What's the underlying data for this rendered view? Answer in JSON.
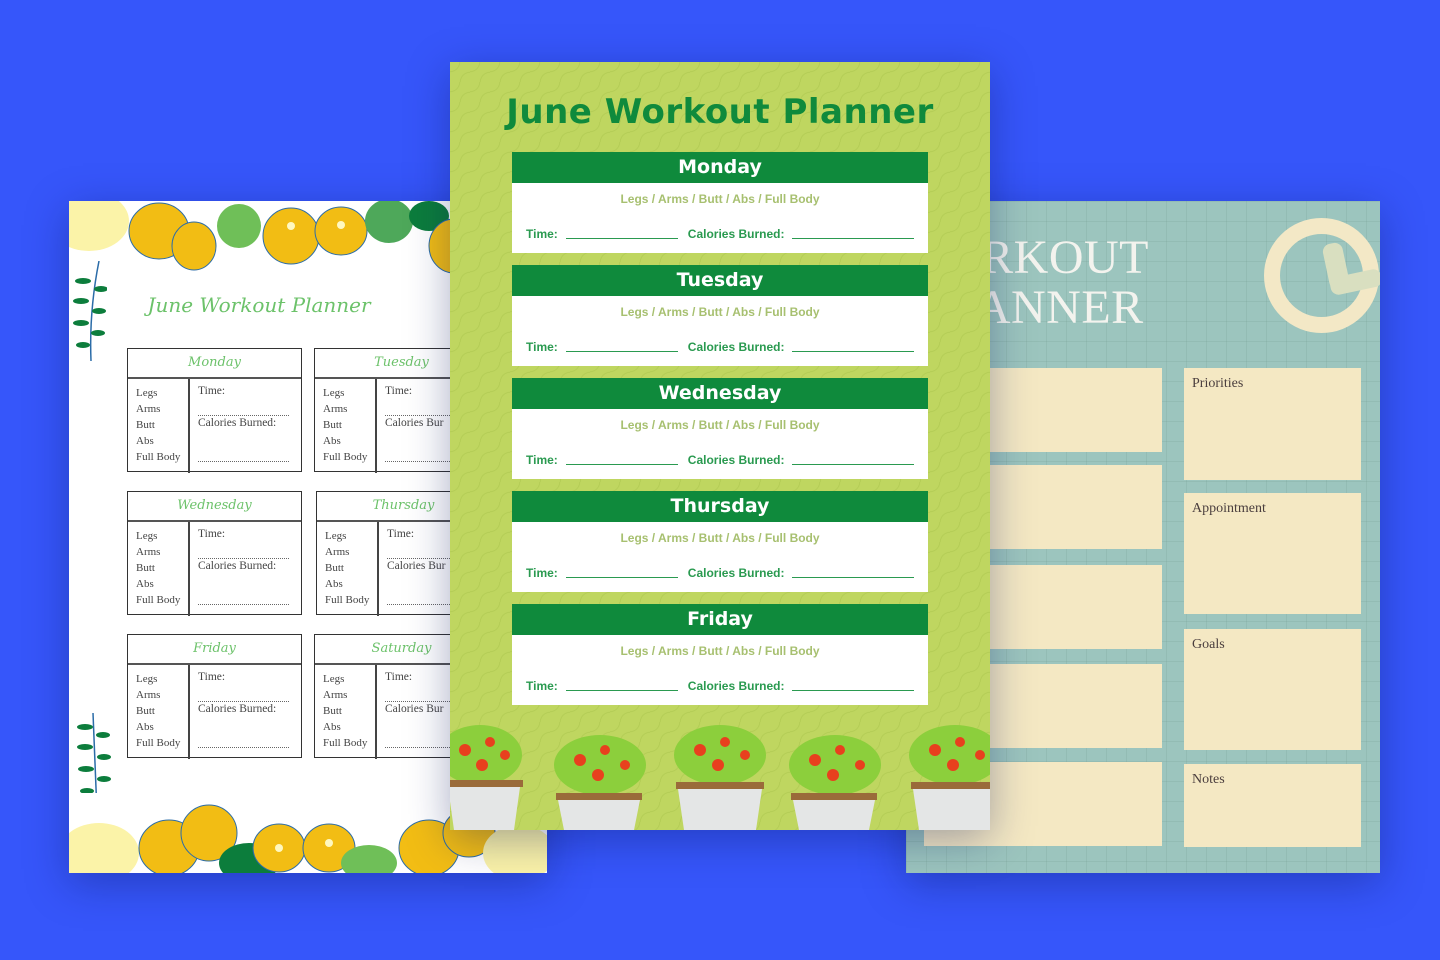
{
  "background_color": "#3656FA",
  "left_planner": {
    "title": "June Workout Planner",
    "title_color": "#6CC26A",
    "body_parts": [
      "Legs",
      "Arms",
      "Butt",
      "Abs",
      "Full Body"
    ],
    "time_label": "Time:",
    "calories_label": "Calories Burned:",
    "days": [
      {
        "name": "Monday"
      },
      {
        "name": "Tuesday"
      },
      {
        "name": "Wednesday"
      },
      {
        "name": "Thursday"
      },
      {
        "name": "Friday"
      },
      {
        "name": "Saturday"
      }
    ],
    "calories_truncated": "Calories Bur"
  },
  "center_planner": {
    "title": "June Workout Planner",
    "accent_color": "#0F8A3C",
    "background_color": "#BFD660",
    "categories": "Legs / Arms / Butt / Abs / Full Body",
    "time_label": "Time:",
    "calories_label": "Calories Burned:",
    "days": [
      {
        "name": "Monday"
      },
      {
        "name": "Tuesday"
      },
      {
        "name": "Wednesday"
      },
      {
        "name": "Thursday"
      },
      {
        "name": "Friday"
      }
    ]
  },
  "right_planner": {
    "title_line1": "ORKOUT",
    "title_line2": "LANNER",
    "background_color": "#9CC5BE",
    "box_color": "#F4E8C3",
    "sections": [
      "Priorities",
      "Appointment",
      "Goals",
      "Notes"
    ]
  }
}
